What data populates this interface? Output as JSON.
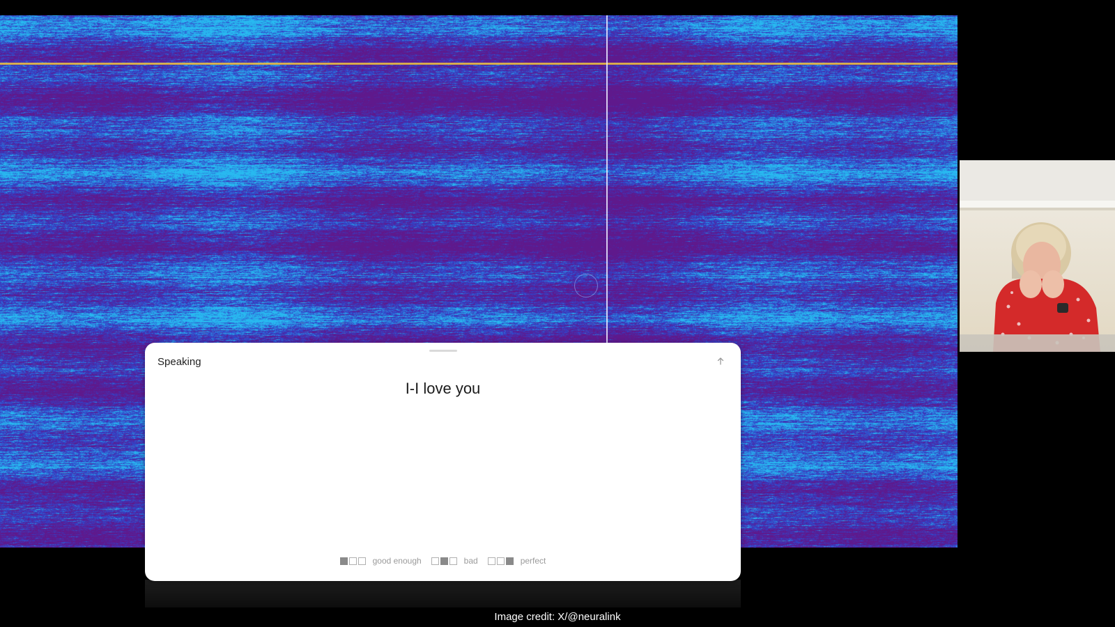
{
  "panel": {
    "title": "Speaking",
    "transcript": "I-I love you",
    "expand_icon": "up-arrow-icon"
  },
  "ratings": [
    {
      "label": "good enough",
      "filled": [
        true,
        false,
        false
      ]
    },
    {
      "label": "bad",
      "filled": [
        false,
        true,
        false
      ]
    },
    {
      "label": "perfect",
      "filled": [
        false,
        false,
        true
      ]
    }
  ],
  "caption": "Image credit: X/@neuralink",
  "colors": {
    "activity_base": "#3a1a86",
    "activity_low": "#5a1f8f",
    "activity_high": "#2fa8e6",
    "highlight_line": "#f2c94c",
    "panel_background": "#ffffff",
    "page_background": "#000000"
  }
}
